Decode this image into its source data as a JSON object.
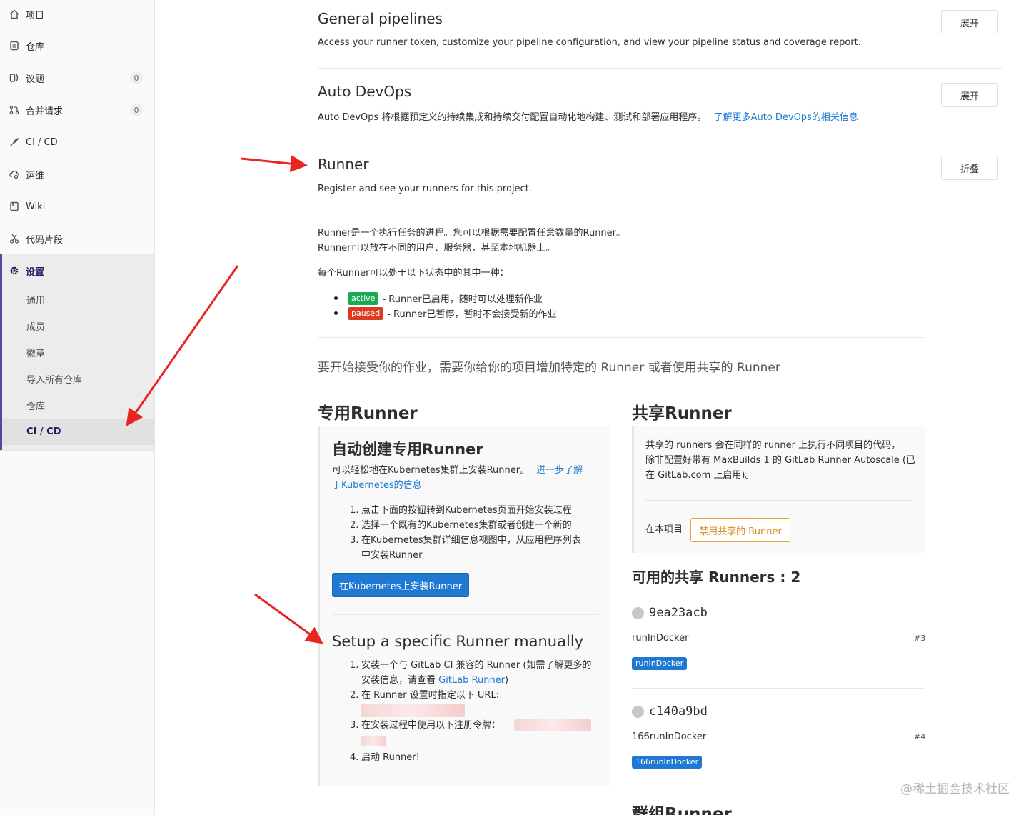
{
  "sidebar": {
    "items": [
      {
        "label": "项目",
        "icon": "home-icon"
      },
      {
        "label": "仓库",
        "icon": "doc-icon"
      },
      {
        "label": "议题",
        "icon": "issues-icon",
        "count": "0"
      },
      {
        "label": "合并请求",
        "icon": "merge-icon",
        "count": "0"
      },
      {
        "label": "CI / CD",
        "icon": "rocket-icon"
      },
      {
        "label": "运维",
        "icon": "cloud-icon"
      },
      {
        "label": "Wiki",
        "icon": "book-icon"
      },
      {
        "label": "代码片段",
        "icon": "scissors-icon"
      },
      {
        "label": "设置",
        "icon": "gear-icon"
      }
    ],
    "sub_items": [
      "通用",
      "成员",
      "徽章",
      "导入所有仓库",
      "仓库",
      "CI / CD"
    ]
  },
  "general": {
    "title": "General pipelines",
    "desc": "Access your runner token, customize your pipeline configuration, and view your pipeline status and coverage report.",
    "button": "展开"
  },
  "devops": {
    "title": "Auto DevOps",
    "desc": "Auto DevOps 将根据预定义的持续集成和持续交付配置自动化地构建、测试和部署应用程序。",
    "link": "了解更多Auto DevOps的相关信息",
    "button": "展开"
  },
  "runner": {
    "title": "Runner",
    "desc": "Register and see your runners for this project.",
    "button": "折叠",
    "p1": "Runner是一个执行任务的进程。您可以根据需要配置任意数量的Runner。",
    "p2": "Runner可以放在不同的用户、服务器，甚至本地机器上。",
    "p3": "每个Runner可以处于以下状态中的其中一种：",
    "state_active_badge": "active",
    "state_active_text": "- Runner已启用，随时可以处理新作业",
    "state_paused_badge": "paused",
    "state_paused_text": "- Runner已暂停，暂时不会接受新的作业",
    "intro": "要开始接受你的作业，需要你给你的项目增加特定的 Runner 或者使用共享的 Runner"
  },
  "specific": {
    "heading": "专用Runner",
    "auto_title": "自动创建专用Runner",
    "auto_desc": "可以轻松地在Kubernetes集群上安装Runner。",
    "auto_link_1": "进一步了解",
    "auto_link_2": "于Kubernetes的信息",
    "steps": [
      "点击下面的按钮转到Kubernetes页面开始安装过程",
      "选择一个既有的Kubernetes集群或者创建一个新的",
      "在Kubernetes集群详细信息视图中，从应用程序列表",
      "中安装Runner"
    ],
    "install_button": "在Kubernetes上安装Runner",
    "manual_title": "Setup a specific Runner manually",
    "m1a": "安装一个与 GitLab CI 兼容的 Runner (如需了解更多的",
    "m1b": "安装信息，请查看 ",
    "m1_link": "GitLab Runner",
    "m1c": ")",
    "m2": "在 Runner 设置时指定以下 URL:",
    "m3": "在安装过程中使用以下注册令牌：",
    "m4": "启动 Runner!"
  },
  "shared": {
    "heading": "共享Runner",
    "d1": "共享的 runners 会在同样的 runner 上执行不同项目的代码，",
    "d2": "除非配置好带有 MaxBuilds 1 的 GitLab Runner Autoscale (已",
    "d3": "在 GitLab.com 上启用)。",
    "in_project": "在本项目",
    "disable_button": "禁用共享的 Runner",
    "available": "可用的共享 Runners : 2",
    "runners": [
      {
        "token": "9ea23acb",
        "desc": "runInDocker",
        "id": "#3",
        "tag": "runInDocker"
      },
      {
        "token": "c140a9bd",
        "desc": "166runInDocker",
        "id": "#4",
        "tag": "166runInDocker"
      }
    ],
    "group_heading": "群组Runner"
  },
  "watermark": "@稀土掘金技术社区",
  "colors": {
    "primary": "#1f78d1",
    "active": "#1aaa55",
    "paused": "#db3b21",
    "arrow": "#e8261f"
  }
}
